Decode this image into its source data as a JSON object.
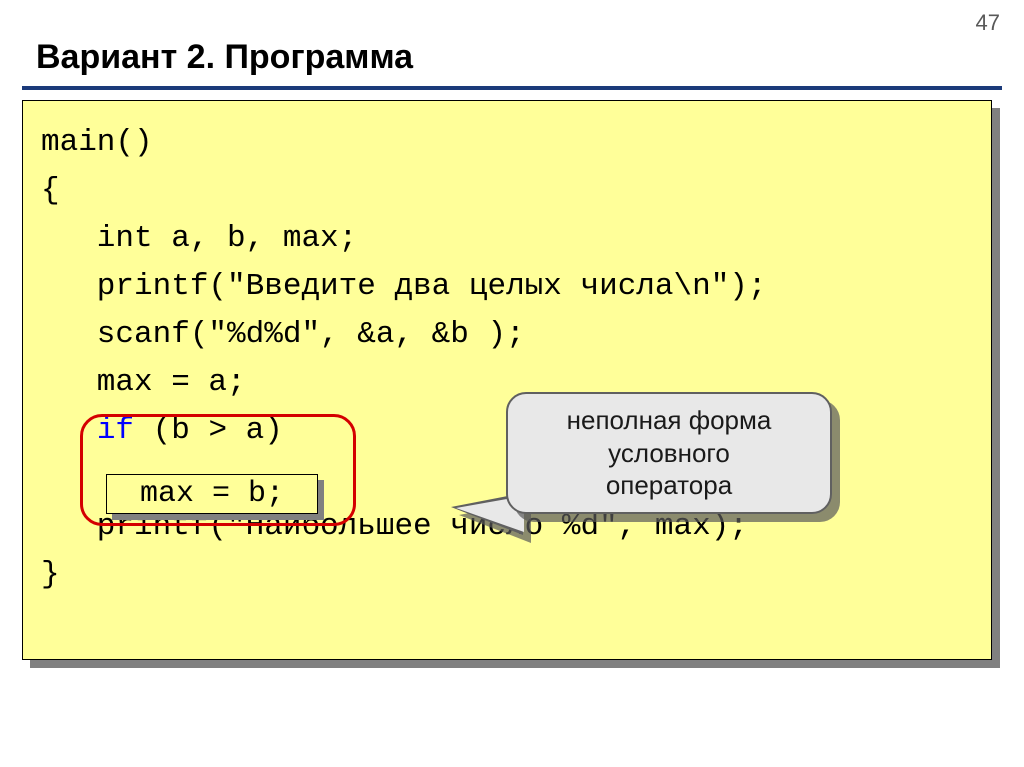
{
  "page_number": "47",
  "title": "Вариант 2. Программа",
  "code": {
    "l1": "main()",
    "l2": "{",
    "l3": "   int a, b, max;",
    "l4": "   printf(\"Введите два целых числа\\n\");",
    "l5": "   scanf(\"%d%d\", &a, &b );",
    "l6": "   max = a;",
    "l7a": "   ",
    "l7_kw": "if",
    "l7b": " (b > a)",
    "l8_blank": " ",
    "l9": "   printf(\"Наибольшее число %d\", max);",
    "l10": "}"
  },
  "mini_box": "max = b;",
  "callout": {
    "line1": "неполная форма",
    "line2": "условного",
    "line3": "оператора"
  }
}
